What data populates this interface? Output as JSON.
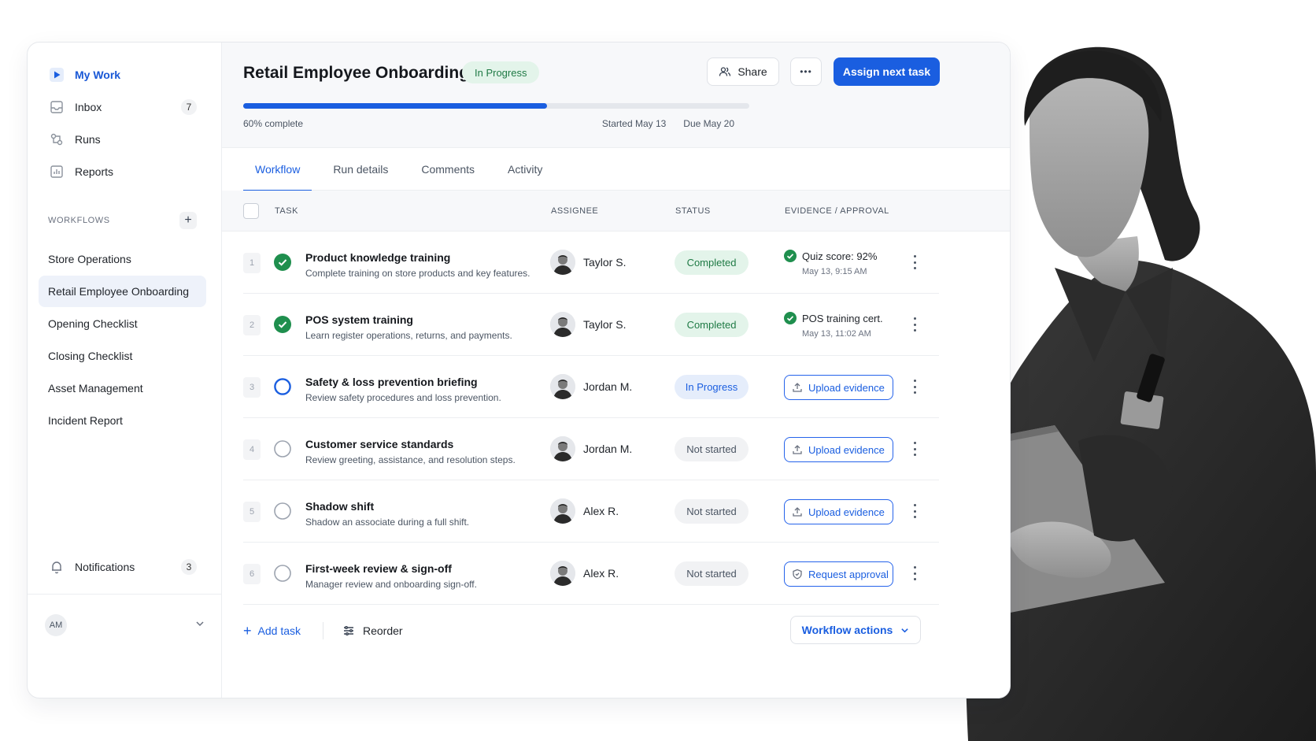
{
  "sidebar": {
    "nav": [
      {
        "label": "My Work",
        "icon": "play-icon",
        "active": true
      },
      {
        "label": "Inbox",
        "icon": "inbox-icon",
        "count": "7"
      },
      {
        "label": "Runs",
        "icon": "runs-icon"
      },
      {
        "label": "Reports",
        "icon": "reports-icon"
      }
    ],
    "workflows_label": "WORKFLOWS",
    "add_label": "+",
    "workflows": [
      "Store Operations",
      "Retail Employee Onboarding",
      "Opening Checklist",
      "Closing Checklist",
      "Asset Management",
      "Incident Report"
    ],
    "active_workflow_index": 1,
    "notifications_label": "Notifications",
    "notifications_count": "3",
    "user_initials": "AM"
  },
  "header": {
    "title": "Retail Employee Onboarding",
    "status": "In Progress",
    "share_label": "Share",
    "more_label": "•••",
    "primary_label": "Assign next task",
    "progress_fraction": 0.6,
    "progress_text": "60% complete",
    "started": "Started May 13",
    "due": "Due May 20"
  },
  "tabs": [
    "Workflow",
    "Run details",
    "Comments",
    "Activity"
  ],
  "active_tab": 0,
  "columns": {
    "task": "TASK",
    "assignee": "ASSIGNEE",
    "status": "STATUS",
    "evidence": "EVIDENCE / APPROVAL"
  },
  "tasks": [
    {
      "num": "1",
      "name": "Product knowledge training",
      "desc": "Complete training on store products and key features.",
      "assignee": "Taylor S.",
      "state": "done",
      "status": "Completed",
      "evidence_title": "Quiz score: 92%",
      "evidence_time": "May 13, 9:15 AM"
    },
    {
      "num": "2",
      "name": "POS system training",
      "desc": "Learn register operations, returns, and payments.",
      "assignee": "Taylor S.",
      "state": "done",
      "status": "Completed",
      "evidence_title": "POS training cert.",
      "evidence_time": "May 13, 11:02 AM"
    },
    {
      "num": "3",
      "name": "Safety & loss prevention briefing",
      "desc": "Review safety procedures and loss prevention.",
      "assignee": "Jordan M.",
      "state": "active",
      "status": "In Progress",
      "action": "Upload evidence",
      "action_icon": "upload-icon"
    },
    {
      "num": "4",
      "name": "Customer service standards",
      "desc": "Review greeting, assistance, and resolution steps.",
      "assignee": "Jordan M.",
      "state": "todo",
      "status": "Not started",
      "action": "Upload evidence",
      "action_icon": "upload-icon"
    },
    {
      "num": "5",
      "name": "Shadow shift",
      "desc": "Shadow an associate during a full shift.",
      "assignee": "Alex R.",
      "state": "todo",
      "status": "Not started",
      "action": "Upload evidence",
      "action_icon": "upload-icon"
    },
    {
      "num": "6",
      "name": "First-week review & sign-off",
      "desc": "Manager review and onboarding sign-off.",
      "assignee": "Alex R.",
      "state": "todo",
      "status": "Not started",
      "action": "Request approval",
      "action_icon": "shield-icon"
    }
  ],
  "footer": {
    "add_task": "Add task",
    "reorder": "Reorder",
    "workflow_actions": "Workflow actions"
  },
  "colors": {
    "accent": "#1a5ee0",
    "success": "#1f8f4e",
    "success_bg": "#e3f4ea"
  }
}
